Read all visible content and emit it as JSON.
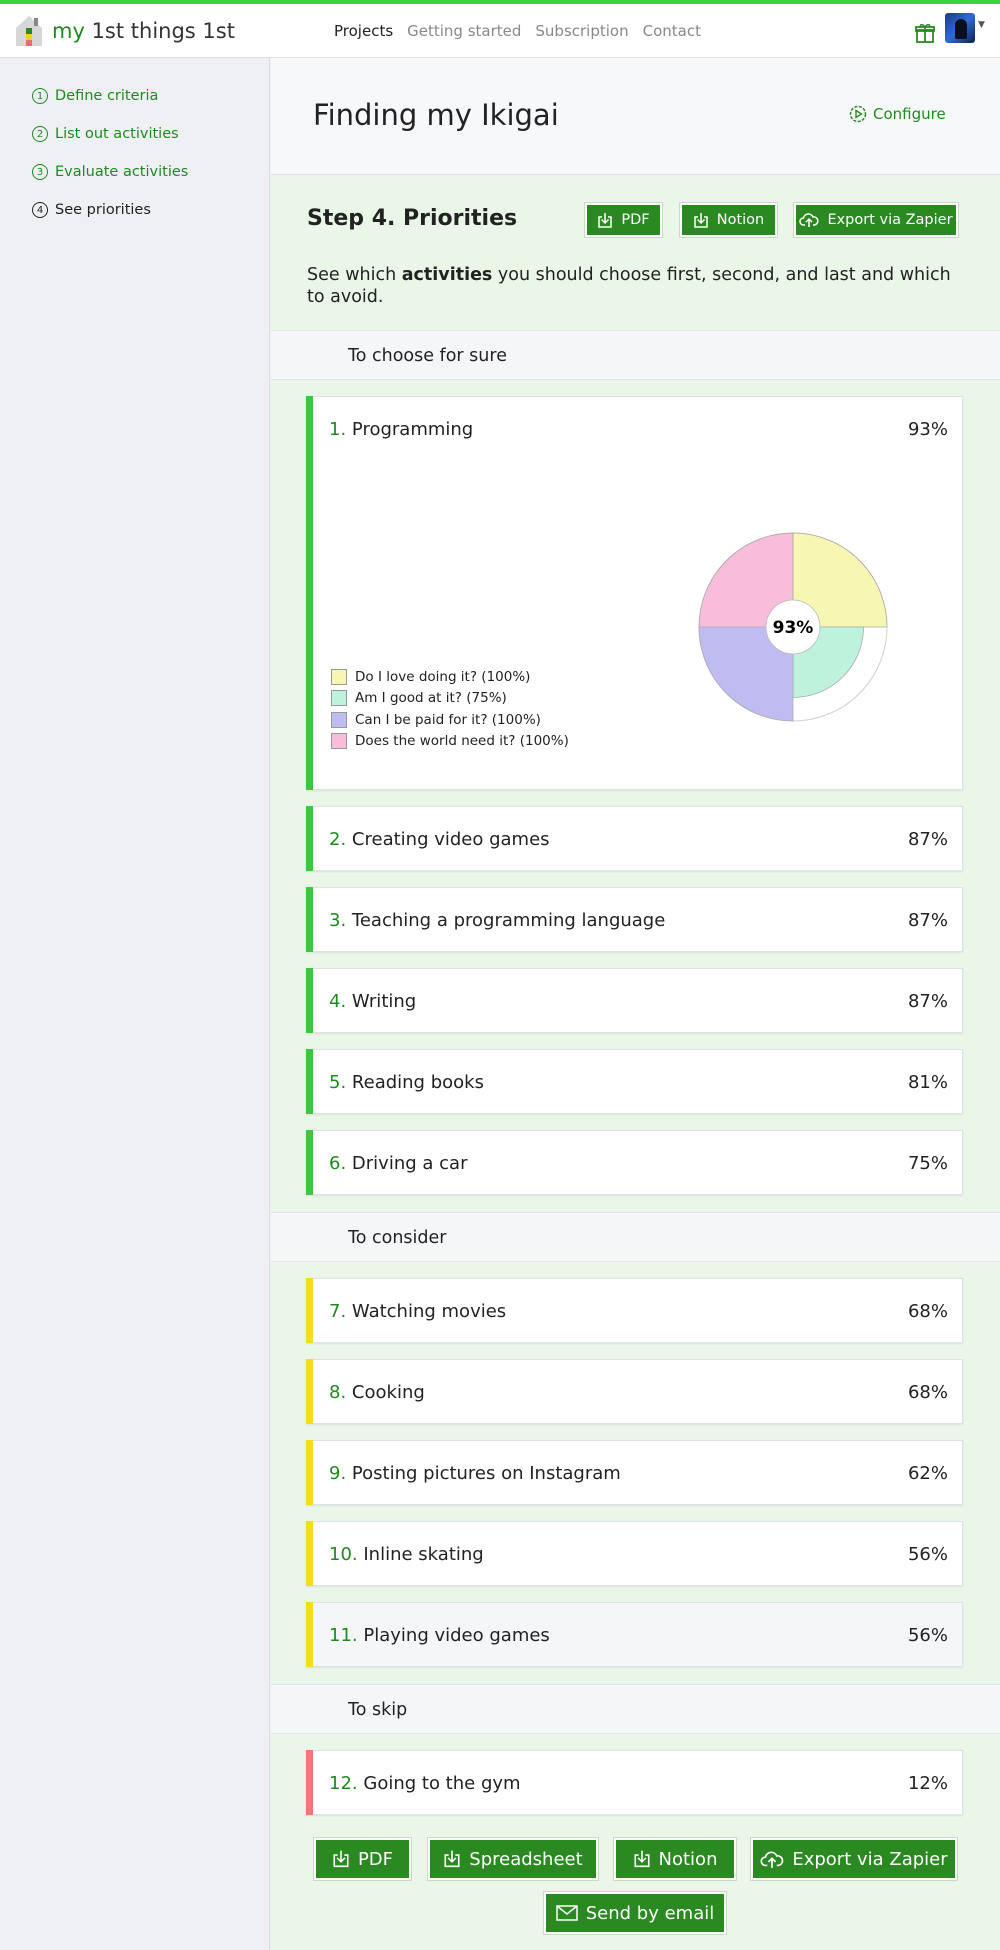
{
  "app": {
    "brand_prefix": "my",
    "brand_rest": " 1st things 1st",
    "nav": [
      "Projects",
      "Getting started",
      "Subscription",
      "Contact"
    ],
    "active_nav": "Projects"
  },
  "sidebar": {
    "steps": [
      {
        "num": "1",
        "label": "Define criteria"
      },
      {
        "num": "2",
        "label": "List out activities"
      },
      {
        "num": "3",
        "label": "Evaluate activities"
      },
      {
        "num": "4",
        "label": "See priorities"
      }
    ]
  },
  "header": {
    "title": "Finding my Ikigai",
    "configure_label": "Configure"
  },
  "step": {
    "heading": "Step 4. Priorities",
    "pdf_label": "PDF",
    "notion_label": "Notion",
    "zapier_label": "Export via Zapier",
    "intro_before": "See which ",
    "intro_bold": "activities",
    "intro_after": " you should choose first, second, and last and which to avoid."
  },
  "sections": {
    "choose": "To choose for sure",
    "consider": "To consider",
    "skip": "To skip"
  },
  "activities": [
    {
      "num": "1.",
      "title": "Programming",
      "pct": "93%"
    },
    {
      "num": "2.",
      "title": "Creating video games",
      "pct": "87%"
    },
    {
      "num": "3.",
      "title": "Teaching a programming language",
      "pct": "87%"
    },
    {
      "num": "4.",
      "title": "Writing",
      "pct": "87%"
    },
    {
      "num": "5.",
      "title": "Reading books",
      "pct": "81%"
    },
    {
      "num": "6.",
      "title": "Driving a car",
      "pct": "75%"
    },
    {
      "num": "7.",
      "title": "Watching movies",
      "pct": "68%"
    },
    {
      "num": "8.",
      "title": "Cooking",
      "pct": "68%"
    },
    {
      "num": "9.",
      "title": "Posting pictures on Instagram",
      "pct": "62%"
    },
    {
      "num": "10.",
      "title": "Inline skating",
      "pct": "56%"
    },
    {
      "num": "11.",
      "title": "Playing video games",
      "pct": "56%"
    },
    {
      "num": "12.",
      "title": "Going to the gym",
      "pct": "12%"
    }
  ],
  "chart_data": {
    "type": "pie",
    "center_label": "93%",
    "series": [
      {
        "name": "Do I love doing it? (100%)",
        "value": 100,
        "color": "#f7f7b3"
      },
      {
        "name": "Am I good at it? (75%)",
        "value": 75,
        "color": "#bff2dc"
      },
      {
        "name": "Can I be paid for it? (100%)",
        "value": 100,
        "color": "#bebcf1"
      },
      {
        "name": "Does the world need it? (100%)",
        "value": 100,
        "color": "#f7bddb"
      }
    ]
  },
  "bottom_actions": {
    "pdf": "PDF",
    "spreadsheet": "Spreadsheet",
    "notion": "Notion",
    "zapier": "Export via Zapier",
    "email": "Send by email"
  },
  "colors": {
    "accent_green": "#2a8a21",
    "bar_choose": "#3cc83c",
    "bar_consider": "#f5dc1e",
    "bar_skip": "#f07878"
  }
}
